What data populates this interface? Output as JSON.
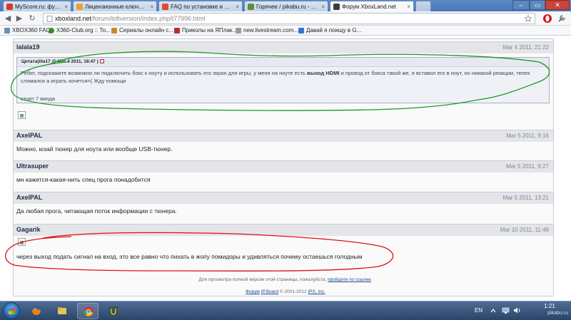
{
  "browser": {
    "tabs": [
      {
        "label": "MyScore.ru: футбол онлайн",
        "favicon_color": "#d93a2b",
        "active": false
      },
      {
        "label": "Лицензионные ключи Steam",
        "favicon_color": "#e9a227",
        "active": false
      },
      {
        "label": "FAQ по установке и экспл",
        "favicon_color": "#e04a2f",
        "active": false
      },
      {
        "label": "Горячее / pikabu.ru - Все",
        "favicon_color": "#5f8f3a",
        "active": false
      },
      {
        "label": "Форум XboxLand.net",
        "favicon_color": "#3b3b3b",
        "active": true
      }
    ],
    "url_host": "xboxland.net",
    "url_path": "/forum/lofiversion/index.php/t77996.html",
    "bookmarks": [
      {
        "label": "XBOX360 FAQ",
        "favicon_color": "#6b8fb8"
      },
      {
        "label": "X360-Club.org :: То...",
        "favicon_color": "#3c8c2a"
      },
      {
        "label": "Сериалы онлайн с...",
        "favicon_color": "#c98a2a"
      },
      {
        "label": "Приколы на ЯПлак...",
        "favicon_color": "#b23030"
      },
      {
        "label": "new.livestream.com...",
        "favicon_color": "#9a9a9a"
      },
      {
        "label": "Давай я поищу в G...",
        "favicon_color": "#3a6fd8"
      }
    ]
  },
  "posts": [
    {
      "author": "lalala19",
      "date": "Mar 4 2011, 21:22",
      "quote_header": "Цитата(ilia17 @ Mar 4 2011, 18:47 )",
      "quote_text_before": "Ребят, подскажите возможно ли подключить бокс к ноуту и использовать его экран для игры, у меня на ноуте есть ",
      "quote_bold": "выход HDMI",
      "quote_text_after": " и провод от бокса такой же, я вставил его в ноут, но никакой реакции, телек сломался а играть хочется=( Жду помощи",
      "quote_extra": "стоит 7 винда"
    },
    {
      "author": "AxelPAL",
      "date": "Mar 5 2011, 9:16",
      "text": "Можно, юзай тюнер для ноута или вообще USB-тюнер."
    },
    {
      "author": "Ultrasuper",
      "date": "Mar 5 2011, 9:27",
      "text": "мн кажется-какая-нить спец прога понадобится"
    },
    {
      "author": "AxelPAL",
      "date": "Mar 5 2011, 13:21",
      "text": "Да любая прога, читающая поток информации с тюнера."
    },
    {
      "author": "Gagarik",
      "date": "Mar 10 2011, 11:46",
      "text": "через выход подать сигнал на вход, это все равно что пихать в жопу помидоры и удивляться почему остаешься голодным"
    }
  ],
  "footer": {
    "line1_text": "Для просмотра полной версии этой страницы, пожалуйста, ",
    "line1_link": "пройдите по ссылке",
    "line2_forum": "Форум",
    "line2_board": "IP.Board",
    "line2_copy": "© 2001-2012",
    "line2_ips": "IPS, Inc."
  },
  "taskbar": {
    "language": "EN",
    "clock_time": "1:21",
    "watermark": "pikabu.ru"
  },
  "annotation_colors": {
    "green": "#1a9a2a",
    "red": "#e01010"
  }
}
